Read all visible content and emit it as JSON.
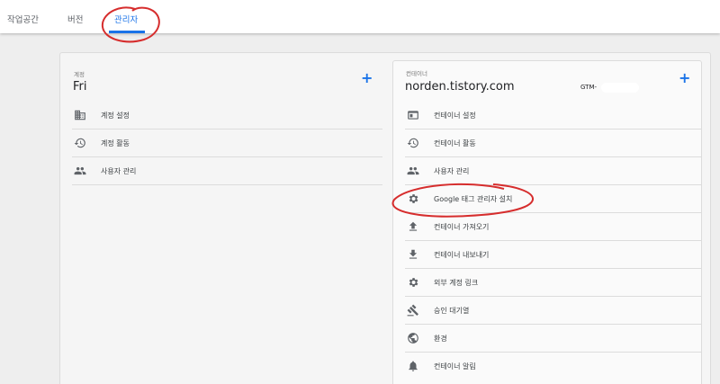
{
  "header": {
    "tabs": [
      {
        "label": "작업공간"
      },
      {
        "label": "버전"
      },
      {
        "label": "관리자"
      }
    ],
    "active_tab": 2
  },
  "account": {
    "label": "계정",
    "name": "Fri",
    "items": [
      {
        "label": "계정 설정",
        "icon": "building-icon"
      },
      {
        "label": "계정 활동",
        "icon": "history-icon"
      },
      {
        "label": "사용자 관리",
        "icon": "people-icon"
      }
    ]
  },
  "container": {
    "label": "컨테이너",
    "name": "norden.tistory.com",
    "id_prefix": "GTM-",
    "items": [
      {
        "label": "컨테이너 설정",
        "icon": "browser-window-icon"
      },
      {
        "label": "컨테이너 활동",
        "icon": "history-icon"
      },
      {
        "label": "사용자 관리",
        "icon": "people-icon"
      },
      {
        "label": "Google 태그 관리자 설치",
        "icon": "gear-icon"
      },
      {
        "label": "컨테이너 가져오기",
        "icon": "upload-icon"
      },
      {
        "label": "컨테이너 내보내기",
        "icon": "download-icon"
      },
      {
        "label": "외부 계정 링크",
        "icon": "gear-icon"
      },
      {
        "label": "승인 대기열",
        "icon": "gavel-icon"
      },
      {
        "label": "환경",
        "icon": "globe-icon"
      },
      {
        "label": "컨테이너 알림",
        "icon": "bell-icon"
      }
    ]
  },
  "colors": {
    "accent": "#1a73e8",
    "annotation": "#d62d2d"
  }
}
